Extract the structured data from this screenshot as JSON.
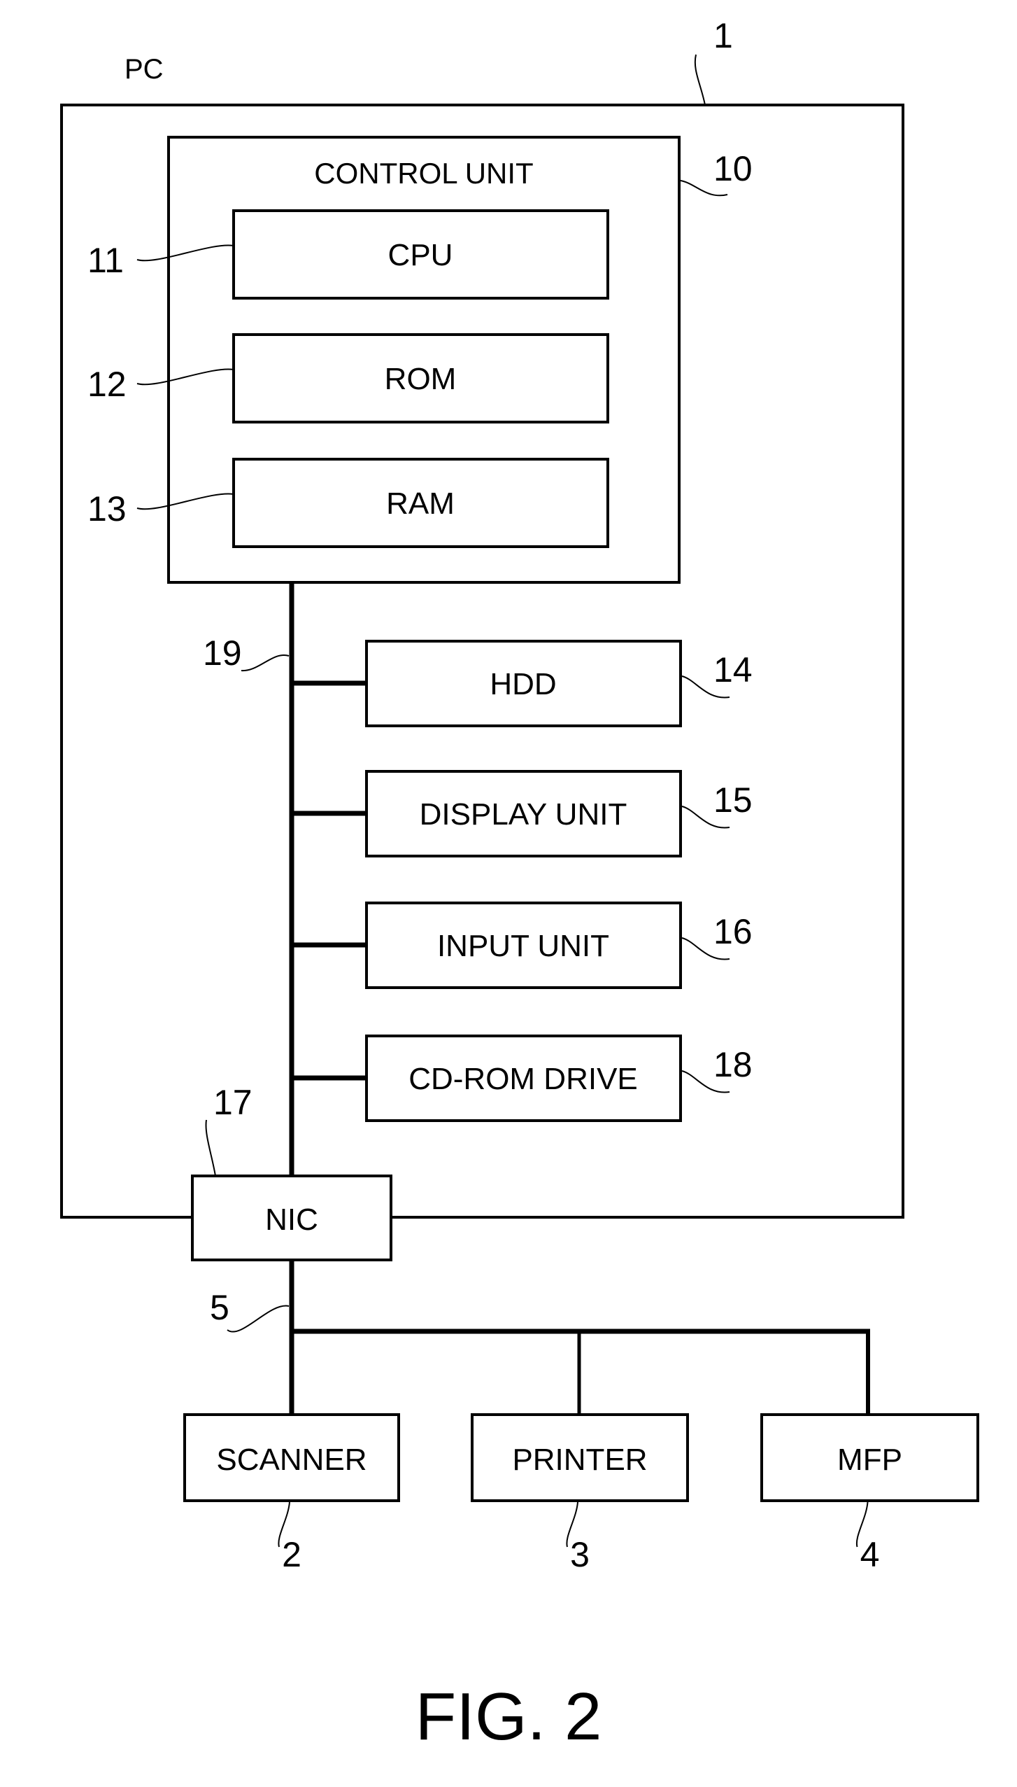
{
  "figure": {
    "caption": "FIG. 2",
    "pc_label": "PC",
    "pc_ref": "1",
    "control_unit": {
      "label": "CONTROL UNIT",
      "ref": "10"
    },
    "control_components": [
      {
        "label": "CPU",
        "ref": "11"
      },
      {
        "label": "ROM",
        "ref": "12"
      },
      {
        "label": "RAM",
        "ref": "13"
      }
    ],
    "bus": {
      "ref": "19"
    },
    "bus_components": [
      {
        "label": "HDD",
        "ref": "14"
      },
      {
        "label": "DISPLAY UNIT",
        "ref": "15"
      },
      {
        "label": "INPUT UNIT",
        "ref": "16"
      },
      {
        "label": "CD-ROM DRIVE",
        "ref": "18"
      }
    ],
    "nic": {
      "label": "NIC",
      "ref": "17"
    },
    "network": {
      "ref": "5"
    },
    "devices": [
      {
        "label": "SCANNER",
        "ref": "2"
      },
      {
        "label": "PRINTER",
        "ref": "3"
      },
      {
        "label": "MFP",
        "ref": "4"
      }
    ]
  }
}
